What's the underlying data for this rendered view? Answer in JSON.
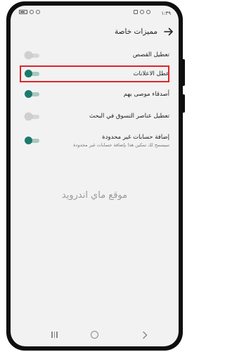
{
  "status_bar": {
    "time": "١:٣٩"
  },
  "app_bar": {
    "title": "مميزات خاصة",
    "back_icon": "arrow-right-icon"
  },
  "settings": [
    {
      "label": "تعطيل القصص",
      "subtitle": "",
      "enabled": false
    },
    {
      "label": "عطل الاعلانات",
      "subtitle": "",
      "enabled": true
    },
    {
      "label": "أصدقاء موصى بهم",
      "subtitle": "",
      "enabled": true
    },
    {
      "label": "تعطيل عناصر التسوق في البحث",
      "subtitle": "",
      "enabled": false
    },
    {
      "label": "إضافة حسابات غير محدودة",
      "subtitle": "سيسمح لك تمكين هذا بإضافة حسابات غير محدودة",
      "enabled": true
    }
  ],
  "watermark": "موقع ماي اندرويد",
  "colors": {
    "toggle_on": "#1b7a6b",
    "toggle_off": "#cfcfcf",
    "highlight": "#e0242b"
  },
  "nav_bar": {
    "icons": [
      "recent-apps-icon",
      "home-icon",
      "back-icon"
    ]
  }
}
